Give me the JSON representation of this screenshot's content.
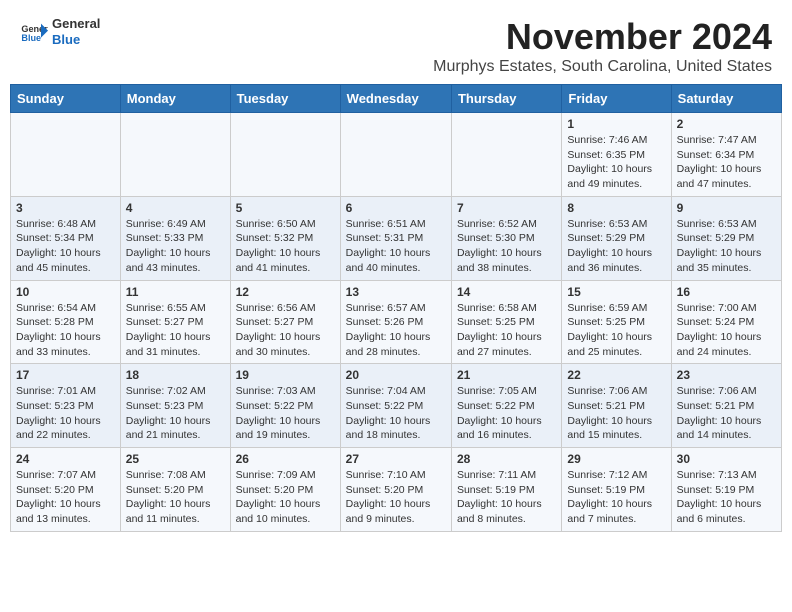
{
  "logo": {
    "general": "General",
    "blue": "Blue"
  },
  "title": "November 2024",
  "subtitle": "Murphys Estates, South Carolina, United States",
  "weekdays": [
    "Sunday",
    "Monday",
    "Tuesday",
    "Wednesday",
    "Thursday",
    "Friday",
    "Saturday"
  ],
  "weeks": [
    [
      {
        "day": "",
        "info": ""
      },
      {
        "day": "",
        "info": ""
      },
      {
        "day": "",
        "info": ""
      },
      {
        "day": "",
        "info": ""
      },
      {
        "day": "",
        "info": ""
      },
      {
        "day": "1",
        "info": "Sunrise: 7:46 AM\nSunset: 6:35 PM\nDaylight: 10 hours\nand 49 minutes."
      },
      {
        "day": "2",
        "info": "Sunrise: 7:47 AM\nSunset: 6:34 PM\nDaylight: 10 hours\nand 47 minutes."
      }
    ],
    [
      {
        "day": "3",
        "info": "Sunrise: 6:48 AM\nSunset: 5:34 PM\nDaylight: 10 hours\nand 45 minutes."
      },
      {
        "day": "4",
        "info": "Sunrise: 6:49 AM\nSunset: 5:33 PM\nDaylight: 10 hours\nand 43 minutes."
      },
      {
        "day": "5",
        "info": "Sunrise: 6:50 AM\nSunset: 5:32 PM\nDaylight: 10 hours\nand 41 minutes."
      },
      {
        "day": "6",
        "info": "Sunrise: 6:51 AM\nSunset: 5:31 PM\nDaylight: 10 hours\nand 40 minutes."
      },
      {
        "day": "7",
        "info": "Sunrise: 6:52 AM\nSunset: 5:30 PM\nDaylight: 10 hours\nand 38 minutes."
      },
      {
        "day": "8",
        "info": "Sunrise: 6:53 AM\nSunset: 5:29 PM\nDaylight: 10 hours\nand 36 minutes."
      },
      {
        "day": "9",
        "info": "Sunrise: 6:53 AM\nSunset: 5:29 PM\nDaylight: 10 hours\nand 35 minutes."
      }
    ],
    [
      {
        "day": "10",
        "info": "Sunrise: 6:54 AM\nSunset: 5:28 PM\nDaylight: 10 hours\nand 33 minutes."
      },
      {
        "day": "11",
        "info": "Sunrise: 6:55 AM\nSunset: 5:27 PM\nDaylight: 10 hours\nand 31 minutes."
      },
      {
        "day": "12",
        "info": "Sunrise: 6:56 AM\nSunset: 5:27 PM\nDaylight: 10 hours\nand 30 minutes."
      },
      {
        "day": "13",
        "info": "Sunrise: 6:57 AM\nSunset: 5:26 PM\nDaylight: 10 hours\nand 28 minutes."
      },
      {
        "day": "14",
        "info": "Sunrise: 6:58 AM\nSunset: 5:25 PM\nDaylight: 10 hours\nand 27 minutes."
      },
      {
        "day": "15",
        "info": "Sunrise: 6:59 AM\nSunset: 5:25 PM\nDaylight: 10 hours\nand 25 minutes."
      },
      {
        "day": "16",
        "info": "Sunrise: 7:00 AM\nSunset: 5:24 PM\nDaylight: 10 hours\nand 24 minutes."
      }
    ],
    [
      {
        "day": "17",
        "info": "Sunrise: 7:01 AM\nSunset: 5:23 PM\nDaylight: 10 hours\nand 22 minutes."
      },
      {
        "day": "18",
        "info": "Sunrise: 7:02 AM\nSunset: 5:23 PM\nDaylight: 10 hours\nand 21 minutes."
      },
      {
        "day": "19",
        "info": "Sunrise: 7:03 AM\nSunset: 5:22 PM\nDaylight: 10 hours\nand 19 minutes."
      },
      {
        "day": "20",
        "info": "Sunrise: 7:04 AM\nSunset: 5:22 PM\nDaylight: 10 hours\nand 18 minutes."
      },
      {
        "day": "21",
        "info": "Sunrise: 7:05 AM\nSunset: 5:22 PM\nDaylight: 10 hours\nand 16 minutes."
      },
      {
        "day": "22",
        "info": "Sunrise: 7:06 AM\nSunset: 5:21 PM\nDaylight: 10 hours\nand 15 minutes."
      },
      {
        "day": "23",
        "info": "Sunrise: 7:06 AM\nSunset: 5:21 PM\nDaylight: 10 hours\nand 14 minutes."
      }
    ],
    [
      {
        "day": "24",
        "info": "Sunrise: 7:07 AM\nSunset: 5:20 PM\nDaylight: 10 hours\nand 13 minutes."
      },
      {
        "day": "25",
        "info": "Sunrise: 7:08 AM\nSunset: 5:20 PM\nDaylight: 10 hours\nand 11 minutes."
      },
      {
        "day": "26",
        "info": "Sunrise: 7:09 AM\nSunset: 5:20 PM\nDaylight: 10 hours\nand 10 minutes."
      },
      {
        "day": "27",
        "info": "Sunrise: 7:10 AM\nSunset: 5:20 PM\nDaylight: 10 hours\nand 9 minutes."
      },
      {
        "day": "28",
        "info": "Sunrise: 7:11 AM\nSunset: 5:19 PM\nDaylight: 10 hours\nand 8 minutes."
      },
      {
        "day": "29",
        "info": "Sunrise: 7:12 AM\nSunset: 5:19 PM\nDaylight: 10 hours\nand 7 minutes."
      },
      {
        "day": "30",
        "info": "Sunrise: 7:13 AM\nSunset: 5:19 PM\nDaylight: 10 hours\nand 6 minutes."
      }
    ]
  ]
}
